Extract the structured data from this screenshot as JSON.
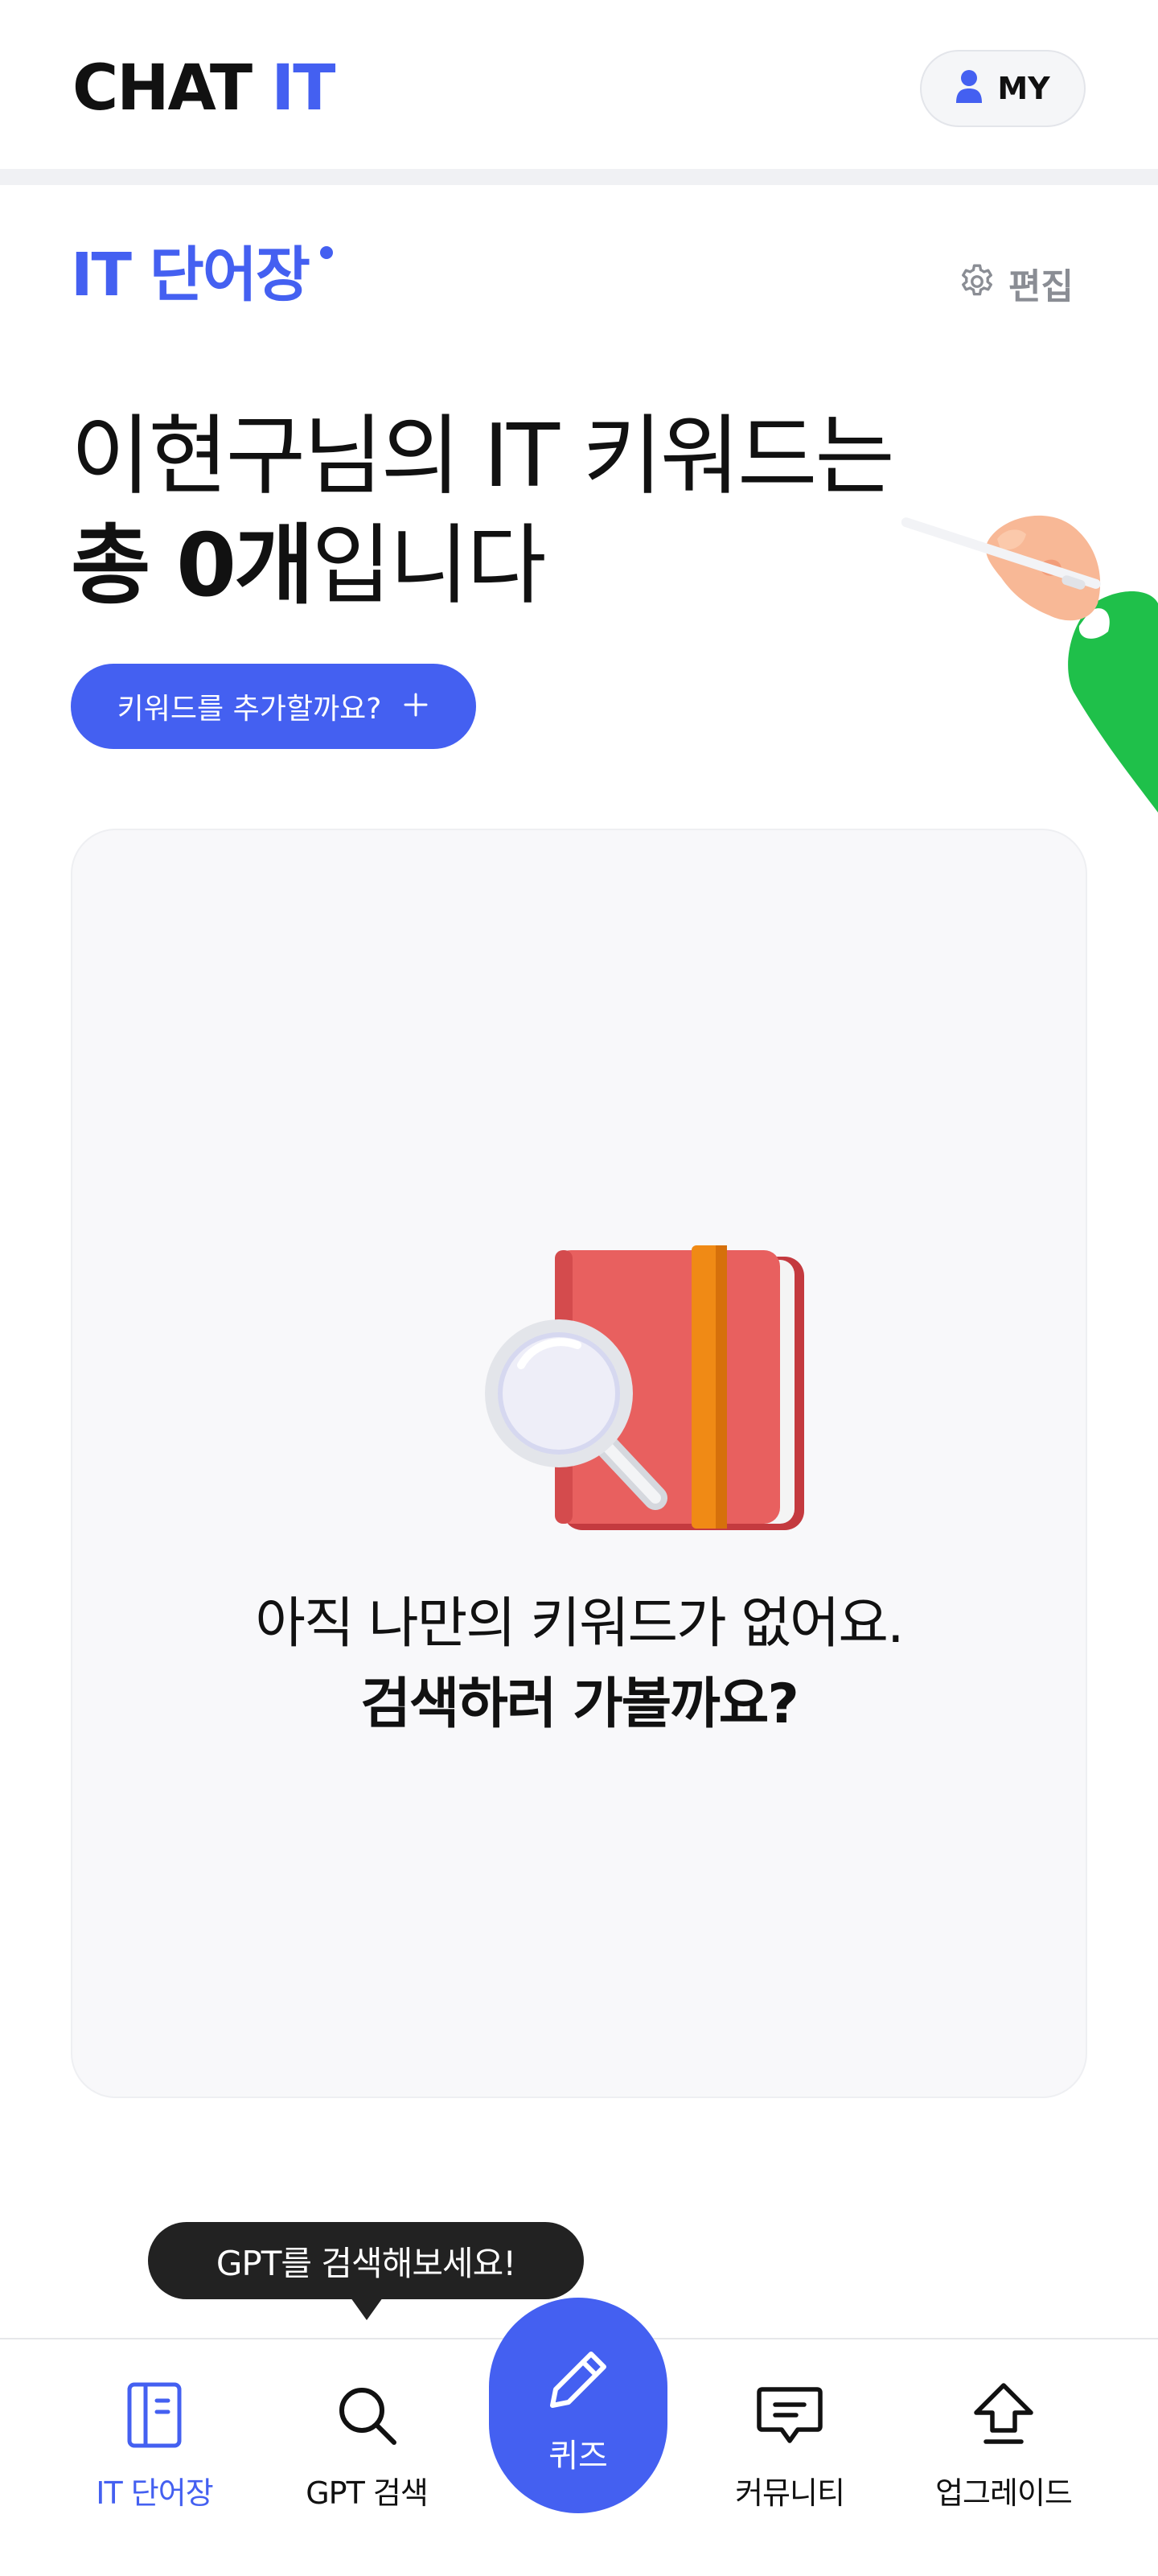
{
  "header": {
    "logo_part1": "CHAT",
    "logo_part2": "IT",
    "my_label": "MY"
  },
  "section": {
    "title": "IT 단어장",
    "edit_label": "편집"
  },
  "headline": {
    "line1": "이현구님의 IT 키워드는",
    "count_text": "총 0개",
    "line2_suffix": "입니다"
  },
  "add_button": {
    "label": "키워드를 추가할까요?",
    "icon": "plus-icon"
  },
  "empty_state": {
    "message": "아직 나만의 키워드가 없어요.",
    "cta": "검색하러 가볼까요?"
  },
  "tooltip": {
    "text": "GPT를 검색해보세요!"
  },
  "nav": {
    "items": [
      {
        "label": "IT 단어장",
        "icon": "notebook-icon",
        "active": true
      },
      {
        "label": "GPT 검색",
        "icon": "search-icon",
        "active": false
      },
      {
        "label": "퀴즈",
        "icon": "pencil-icon",
        "active": false
      },
      {
        "label": "커뮤니티",
        "icon": "chat-bubble-icon",
        "active": false
      },
      {
        "label": "업그레이드",
        "icon": "upload-arrow-icon",
        "active": false
      }
    ]
  },
  "colors": {
    "accent": "#4460f1",
    "text": "#111111",
    "muted": "#8a8d94",
    "card_bg": "#f8f8fa",
    "tooltip_bg": "#222222"
  }
}
